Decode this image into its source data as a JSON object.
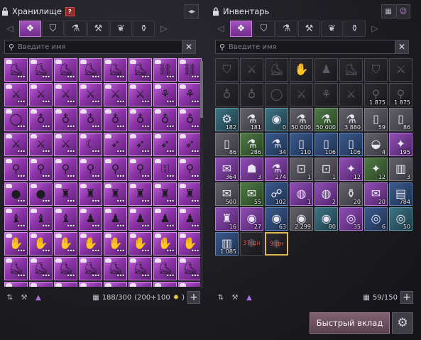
{
  "storage": {
    "title": "Хранилище",
    "help_icon_label": "?",
    "top_button_icon": "merge-arrows-icon",
    "tabs": [
      {
        "icon": "all-grid-icon",
        "glyph": "❖",
        "active": true
      },
      {
        "icon": "armor-icon",
        "glyph": "⛉",
        "active": false
      },
      {
        "icon": "potion-icon",
        "glyph": "⚗",
        "active": false
      },
      {
        "icon": "anvil-icon",
        "glyph": "⚒",
        "active": false
      },
      {
        "icon": "leaf-icon",
        "glyph": "❦",
        "active": false
      },
      {
        "icon": "pouch-icon",
        "glyph": "⚱",
        "active": false
      }
    ],
    "search": {
      "placeholder": "Введите имя",
      "value": ""
    },
    "capacity": {
      "used": "188/300",
      "bonus": "(200+100",
      "bonus_close": ")"
    },
    "bottom_icons": [
      "sort-icon",
      "anvil-icon",
      "grade-filter-icon"
    ],
    "slots": [
      {
        "t": "rare",
        "g": "⛸",
        "b": 1,
        "d": 1
      },
      {
        "t": "rare",
        "g": "⛸",
        "b": 1,
        "d": 1
      },
      {
        "t": "rare",
        "g": "⛸",
        "b": 1,
        "d": 1
      },
      {
        "t": "rare",
        "g": "⛸",
        "b": 1,
        "d": 1
      },
      {
        "t": "rare",
        "g": "⛸",
        "b": 1,
        "d": 1
      },
      {
        "t": "rare",
        "g": "⛸",
        "b": 1,
        "d": 1
      },
      {
        "t": "rare",
        "g": "⛓",
        "b": 1,
        "d": 1
      },
      {
        "t": "rare",
        "g": "⛓",
        "b": 1,
        "d": 1
      },
      {
        "t": "rare",
        "g": "⚔",
        "b": 1,
        "d": 1
      },
      {
        "t": "rare",
        "g": "⚔",
        "b": 1,
        "d": 1
      },
      {
        "t": "rare",
        "g": "⚔",
        "b": 1,
        "d": 1
      },
      {
        "t": "rare",
        "g": "⚔",
        "b": 1,
        "d": 1
      },
      {
        "t": "rare",
        "g": "⚔",
        "b": 1,
        "d": 1
      },
      {
        "t": "rare",
        "g": "⚔",
        "b": 1,
        "d": 1
      },
      {
        "t": "rare",
        "g": "⚘",
        "b": 1,
        "d": 1
      },
      {
        "t": "rare",
        "g": "⚘",
        "b": 1,
        "d": 1
      },
      {
        "t": "rare",
        "g": "◯",
        "b": 1,
        "d": 1
      },
      {
        "t": "rare",
        "g": "♁",
        "b": 1,
        "d": 1
      },
      {
        "t": "rare",
        "g": "♁",
        "b": 1,
        "d": 1
      },
      {
        "t": "rare",
        "g": "♁",
        "b": 1,
        "d": 1
      },
      {
        "t": "rare",
        "g": "♁",
        "b": 1,
        "d": 1
      },
      {
        "t": "rare",
        "g": "♁",
        "b": 1,
        "d": 1
      },
      {
        "t": "rare",
        "g": "♁",
        "b": 1,
        "d": 1
      },
      {
        "t": "rare",
        "g": "♁",
        "b": 1,
        "d": 1
      },
      {
        "t": "rare",
        "g": "⚔",
        "b": 1,
        "d": 1
      },
      {
        "t": "rare",
        "g": "⚔",
        "b": 1,
        "d": 1
      },
      {
        "t": "rare",
        "g": "⚔",
        "b": 1,
        "d": 1
      },
      {
        "t": "rare",
        "g": "☾",
        "b": 1,
        "d": 1
      },
      {
        "t": "rare",
        "g": "➶",
        "b": 1,
        "d": 1
      },
      {
        "t": "rare",
        "g": "➶",
        "b": 1,
        "d": 1
      },
      {
        "t": "rare",
        "g": "➶",
        "b": 1,
        "d": 1
      },
      {
        "t": "rare",
        "g": "➶",
        "b": 1,
        "d": 1
      },
      {
        "t": "rare",
        "g": "⚲",
        "b": 1,
        "d": 1
      },
      {
        "t": "rare",
        "g": "⚲",
        "b": 1,
        "d": 1
      },
      {
        "t": "rare",
        "g": "⚲",
        "b": 1,
        "d": 1
      },
      {
        "t": "rare",
        "g": "⚲",
        "b": 1,
        "d": 1
      },
      {
        "t": "rare",
        "g": "⚲",
        "b": 1,
        "d": 1
      },
      {
        "t": "rare",
        "g": "⚲",
        "b": 1,
        "d": 1
      },
      {
        "t": "rare",
        "g": "⚿",
        "b": 1,
        "d": 1
      },
      {
        "t": "rare",
        "g": "⚲",
        "b": 1,
        "d": 1
      },
      {
        "t": "rare",
        "g": "●",
        "b": 1,
        "d": 1
      },
      {
        "t": "rare",
        "g": "●",
        "b": 1,
        "d": 1
      },
      {
        "t": "rare",
        "g": "♜",
        "b": 1,
        "d": 1
      },
      {
        "t": "rare",
        "g": "♜",
        "b": 1,
        "d": 1
      },
      {
        "t": "rare",
        "g": "♜",
        "b": 1,
        "d": 1
      },
      {
        "t": "rare",
        "g": "♜",
        "b": 1,
        "d": 1
      },
      {
        "t": "rare",
        "g": "♜",
        "b": 1,
        "d": 1
      },
      {
        "t": "rare",
        "g": "♜",
        "b": 1,
        "d": 1
      },
      {
        "t": "rare",
        "g": "♝",
        "b": 1,
        "d": 1
      },
      {
        "t": "rare",
        "g": "♝",
        "b": 1,
        "d": 1
      },
      {
        "t": "rare",
        "g": "♝",
        "b": 1,
        "d": 1
      },
      {
        "t": "rare",
        "g": "♟",
        "b": 1,
        "d": 1
      },
      {
        "t": "rare",
        "g": "♟",
        "b": 1,
        "d": 1
      },
      {
        "t": "rare",
        "g": "♟",
        "b": 1,
        "d": 1
      },
      {
        "t": "rare",
        "g": "♟",
        "b": 1,
        "d": 1
      },
      {
        "t": "rare",
        "g": "♟",
        "b": 1,
        "d": 1
      },
      {
        "t": "rare",
        "g": "✋",
        "b": 1,
        "d": 1
      },
      {
        "t": "rare",
        "g": "✋",
        "b": 1,
        "d": 1
      },
      {
        "t": "rare",
        "g": "✋",
        "b": 1,
        "d": 1
      },
      {
        "t": "rare",
        "g": "✋",
        "b": 1,
        "d": 1
      },
      {
        "t": "rare",
        "g": "✋",
        "b": 1,
        "d": 1
      },
      {
        "t": "rare",
        "g": "✋",
        "b": 1,
        "d": 1
      },
      {
        "t": "rare",
        "g": "✋",
        "b": 1,
        "d": 1
      },
      {
        "t": "rare",
        "g": "✋",
        "b": 1,
        "d": 1
      },
      {
        "t": "rare",
        "g": "⛸",
        "b": 1,
        "d": 1
      },
      {
        "t": "rare",
        "g": "⛸",
        "b": 1,
        "d": 1
      },
      {
        "t": "rare",
        "g": "⛸",
        "b": 1,
        "d": 1
      },
      {
        "t": "rare",
        "g": "⛸",
        "b": 1,
        "d": 1
      },
      {
        "t": "rare",
        "g": "⛸",
        "b": 1,
        "d": 1
      },
      {
        "t": "rare",
        "g": "⛸",
        "b": 1,
        "d": 1
      },
      {
        "t": "rare",
        "g": "⛸",
        "b": 1,
        "d": 1
      },
      {
        "t": "rare",
        "g": "⛸",
        "b": 1,
        "d": 1
      },
      {
        "t": "rare",
        "g": "⛸",
        "b": 1,
        "d": 0
      },
      {
        "t": "rare",
        "g": "⛸",
        "b": 1,
        "d": 0
      },
      {
        "t": "rare",
        "g": "⛸",
        "b": 1,
        "d": 0
      },
      {
        "t": "rare",
        "g": "⛸",
        "b": 1,
        "d": 0
      },
      {
        "t": "rare",
        "g": "⛸",
        "b": 1,
        "d": 0
      },
      {
        "t": "rare",
        "g": "⛸",
        "b": 1,
        "d": 0
      },
      {
        "t": "rare",
        "g": "⛸",
        "b": 1,
        "d": 0
      },
      {
        "t": "rare",
        "g": "⛸",
        "b": 1,
        "d": 0
      }
    ]
  },
  "inventory": {
    "title": "Инвентарь",
    "top_button_icons": [
      "layout-icon",
      "emote-icon"
    ],
    "tabs": [
      {
        "icon": "all-grid-icon",
        "glyph": "❖",
        "active": true
      },
      {
        "icon": "armor-icon",
        "glyph": "⛉",
        "active": false
      },
      {
        "icon": "potion-icon",
        "glyph": "⚗",
        "active": false
      },
      {
        "icon": "anvil-icon",
        "glyph": "⚒",
        "active": false
      },
      {
        "icon": "leaf-icon",
        "glyph": "❦",
        "active": false
      },
      {
        "icon": "pouch-icon",
        "glyph": "⚱",
        "active": false
      }
    ],
    "search": {
      "placeholder": "Введите имя",
      "value": ""
    },
    "capacity": {
      "used": "59/150"
    },
    "bottom_icons": [
      "sort-icon",
      "anvil-icon",
      "grade-filter-icon"
    ],
    "slots": [
      {
        "t": "dark",
        "g": "⛉"
      },
      {
        "t": "dark",
        "g": "⚔"
      },
      {
        "t": "dark",
        "g": "⛸"
      },
      {
        "t": "dark",
        "g": "✋"
      },
      {
        "t": "dark",
        "g": "♟"
      },
      {
        "t": "dark",
        "g": "⛸"
      },
      {
        "t": "dark",
        "g": "⛉"
      },
      {
        "t": "dark",
        "g": "⚔"
      },
      {
        "t": "dark",
        "g": "♁"
      },
      {
        "t": "dark",
        "g": "♁"
      },
      {
        "t": "dark",
        "g": "◯"
      },
      {
        "t": "dark",
        "g": "⚔"
      },
      {
        "t": "dark",
        "g": "⚘"
      },
      {
        "t": "dark",
        "g": "⚔"
      },
      {
        "t": "dark",
        "g": "⚲",
        "c": "1 875"
      },
      {
        "t": "dark",
        "g": "⚲",
        "c": "1 875"
      },
      {
        "t": "teal",
        "g": "⚙",
        "c": "182"
      },
      {
        "t": "gray",
        "g": "⚗",
        "c": "181"
      },
      {
        "t": "teal",
        "g": "◉",
        "c": "0"
      },
      {
        "t": "gray",
        "g": "⚗",
        "c": "50 000"
      },
      {
        "t": "green",
        "g": "⚗",
        "c": "50 000"
      },
      {
        "t": "gray",
        "g": "⚗",
        "c": "3 880"
      },
      {
        "t": "gray",
        "g": "▯",
        "c": "59"
      },
      {
        "t": "gray",
        "g": "▯",
        "c": "86"
      },
      {
        "t": "gray",
        "g": "▯",
        "c": "86"
      },
      {
        "t": "green",
        "g": "⚗",
        "c": "286"
      },
      {
        "t": "blue",
        "g": "⚗",
        "c": "34"
      },
      {
        "t": "blue",
        "g": "▯",
        "c": "110"
      },
      {
        "t": "blue",
        "g": "▯",
        "c": "106"
      },
      {
        "t": "blue",
        "g": "▯",
        "c": "106"
      },
      {
        "t": "gray",
        "g": "◒",
        "c": "4"
      },
      {
        "t": "violet",
        "g": "✦",
        "c": "195"
      },
      {
        "t": "violet",
        "g": "✉",
        "c": "364"
      },
      {
        "t": "violet",
        "g": "☗",
        "c": "3"
      },
      {
        "t": "violet",
        "g": "⚗",
        "c": "274"
      },
      {
        "t": "gray",
        "g": "⊡",
        "c": "1"
      },
      {
        "t": "gray",
        "g": "⊡",
        "c": "1"
      },
      {
        "t": "violet",
        "g": "✦",
        "c": "12"
      },
      {
        "t": "green",
        "g": "✦",
        "c": "12"
      },
      {
        "t": "gray",
        "g": "▥",
        "c": "3"
      },
      {
        "t": "gray",
        "g": "✉",
        "c": "500"
      },
      {
        "t": "green",
        "g": "✉",
        "c": "55"
      },
      {
        "t": "blue",
        "g": "☍",
        "c": "102"
      },
      {
        "t": "violet",
        "g": "◍",
        "c": "1"
      },
      {
        "t": "violet",
        "g": "◍",
        "c": "2"
      },
      {
        "t": "gray",
        "g": "⚱",
        "c": "20"
      },
      {
        "t": "violet",
        "g": "✉",
        "c": "20"
      },
      {
        "t": "blue",
        "g": "▤",
        "c": "784"
      },
      {
        "t": "violet",
        "g": "♜",
        "c": "16"
      },
      {
        "t": "violet",
        "g": "◉",
        "c": "27"
      },
      {
        "t": "blue",
        "g": "◉",
        "c": "63"
      },
      {
        "t": "gray",
        "g": "◉",
        "c": "2 299"
      },
      {
        "t": "teal",
        "g": "◉",
        "c": "80"
      },
      {
        "t": "violet",
        "g": "◎",
        "c": "35"
      },
      {
        "t": "blue",
        "g": "◎",
        "c": "6"
      },
      {
        "t": "teal",
        "g": "◎",
        "c": "50"
      },
      {
        "t": "blue",
        "g": "▥",
        "c": "1 085"
      },
      {
        "t": "dark",
        "g": "✺",
        "days": "37 дн"
      },
      {
        "t": "dark",
        "g": "✺",
        "days": "9 дн",
        "sel": 1
      }
    ]
  },
  "quick_deposit_label": "Быстрый вклад",
  "settings_icon": "gear-icon",
  "colors": {
    "rare": "#a045c0",
    "accent_selected": "#e2b750",
    "days_text": "#e05c4c"
  }
}
